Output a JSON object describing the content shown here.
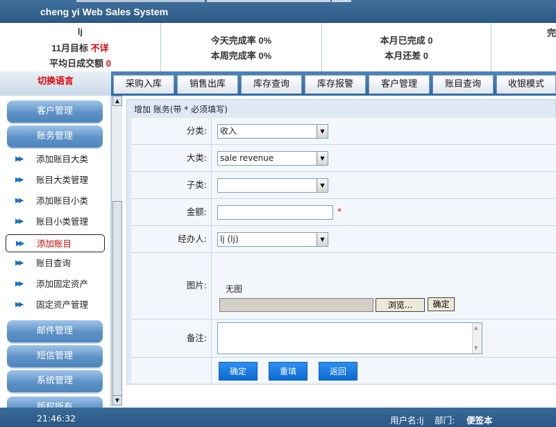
{
  "app": {
    "title": "cheng yi Web Sales System"
  },
  "stats": {
    "user": "lj",
    "monthly_target_label": "11月目标",
    "monthly_target_value": "不详",
    "avg_daily_label": "平均日成交额",
    "avg_daily_value": "0",
    "today_rate_label": "今天完成率",
    "today_rate_value": "0%",
    "week_rate_label": "本周完成率",
    "week_rate_value": "0%",
    "month_done_label": "本月已完成",
    "month_done_value": "0",
    "month_gap_label": "本月还差",
    "month_gap_value": "0",
    "cut_text": "完"
  },
  "nav": {
    "lang_switch": "切换语言",
    "tabs": [
      "采购入库",
      "销售出库",
      "库存查询",
      "库存报警",
      "客户管理",
      "账目查询",
      "收银模式"
    ]
  },
  "sidebar": {
    "groups": {
      "customer": "客户管理",
      "accounts": "账务管理",
      "mail": "邮件管理",
      "sms": "短信管理",
      "system": "系统管理",
      "bottom_cut": "版权所有"
    },
    "items": [
      "添加账目大类",
      "账目大类管理",
      "添加账目小类",
      "账目小类管理",
      "添加账目",
      "账目查询",
      "添加固定资产",
      "固定资产管理"
    ],
    "arrow_glyph": "▶▶"
  },
  "form": {
    "title": "增加 账务(带 * 必须填写)",
    "category_label": "分类:",
    "category_value": "收入",
    "major_label": "大类:",
    "major_value": "sale revenue",
    "minor_label": "子类:",
    "minor_value": "",
    "amount_label": "金额:",
    "amount_value": "",
    "required_mark": "*",
    "handler_label": "经办人:",
    "handler_value": "lj (lj)",
    "image_label": "图片:",
    "image_none": "无图",
    "browse_button": "浏览...",
    "upload_confirm": "确定",
    "remark_label": "备注:",
    "confirm_button": "确定",
    "reset_button": "重填",
    "back_button": "返回"
  },
  "status": {
    "time": "21:46:32",
    "username_label": "用户名:lj",
    "dept_label": "部门:",
    "dept_value": "便签本"
  },
  "colors": {
    "accent_blue": "#2f6aa6",
    "required_red": "#e00000",
    "button_blue": "#1a7be0"
  }
}
